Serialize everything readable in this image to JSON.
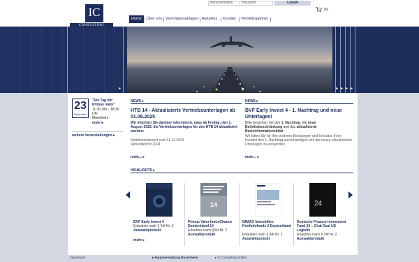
{
  "brand": {
    "logo_text": "IC",
    "logo_word": "CONSULTING"
  },
  "login": {
    "username_placeholder": "Benutzername",
    "password_placeholder": "Passwort",
    "button_label": "LOGIN",
    "cart_count": "(0)"
  },
  "nav": {
    "items": [
      {
        "label": "Home"
      },
      {
        "label": "Über uns"
      },
      {
        "label": "Vermögensanlagen"
      },
      {
        "label": "Aktuelles"
      },
      {
        "label": "Kontakt"
      },
      {
        "label": "Vertriebspartner"
      }
    ]
  },
  "event": {
    "day": "23",
    "month": "September",
    "title": "\"Ein Tag mit",
    "title2": "Primus Valor\"",
    "time": "11:30 Uhr - 18:30",
    "time2": "Uhr",
    "city": "Mannheim",
    "more": "mehr",
    "more_events": "weitere Veranstaltungen"
  },
  "news": [
    {
      "head": "NEWS",
      "title": "HTB 14 - Aktualisierte Vertriebsunterlagen ab 01.08.2025",
      "body": "Wir möchten Sie darüber informieren, dass ab Freitag, den 1. August 2025, die Vertriebsunterlagen für den HTB 14 aktualisiert werden:",
      "line1": "Nettoinventarwert zum 31.12.2024",
      "line2": "Jahresbericht 2024",
      "more": "mehr..."
    },
    {
      "head": "NEWS",
      "title": "BVF Early Invest 4 - 1. Nachtrag und neue Unterlagen!",
      "body_a": "Bitte beachten Sie den ",
      "body_b": "1. Nachtrag",
      "body_c": ", die ",
      "body_d": "neue Beitrittsbeschränkung",
      "body_e": " und das ",
      "body_f": "aktualisierte Basisinformationsblatt",
      "body_g": ".",
      "body2": "Wir bitten Sie für Ihre weiteren Beratungen und Umsätze Ihren Kunden den 1. Nachtrag auszuhändigen und die neuen aktualisierten Unterlagen zu verwenden.",
      "more": "mehr..."
    }
  ],
  "highlights": {
    "head": "HIGHLIGHTS",
    "products": [
      {
        "title": "BVF Early Invest 4",
        "note": "Erlaubnis nach § 34f Nr. 2",
        "tag": "Auswahlprodukt",
        "more": "mehr"
      },
      {
        "title": "Primus Valor ImmoChance Deutschland 14",
        "note": "Erlaubnis nach §34f Nr. 2",
        "tag": "Auswahlprodukt",
        "cover_number": "14"
      },
      {
        "title": "IMMAC Immobilien Portfoliofonds 2 Deutschland",
        "note": "Erlaubnis nach § 34f Nr. 2",
        "tag": "Auswahlprodukt"
      },
      {
        "title": "Deutsche Finance Investment Fund 24 – Club Deal US Logistik",
        "note": "Erlaubnis nach § 34f Nr. 2",
        "tag": "Auswahlprodukt",
        "cover_number": "24"
      }
    ]
  },
  "footer": {
    "left": "Impressum",
    "mid": "Hauptverwaltung Rosenheim",
    "right": "IC Consulting GmbH"
  },
  "colors": {
    "primary": "#1d2d5c",
    "page_bg": "#d3d7e1"
  }
}
